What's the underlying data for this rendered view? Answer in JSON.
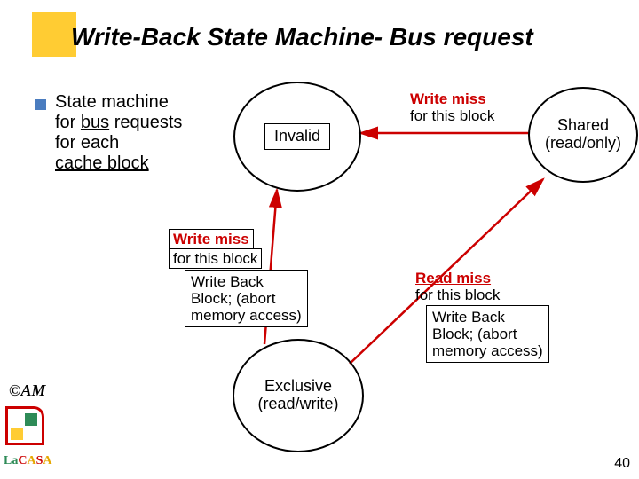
{
  "title": "Write-Back State Machine- Bus request",
  "bullet": {
    "l1": "State machine",
    "l2a": "for ",
    "l2b": "bus",
    "l2c": " requests",
    "l3": " for each",
    "l4": "cache block"
  },
  "states": {
    "invalid": "Invalid",
    "shared_l1": "Shared",
    "shared_l2": "(read/only)",
    "excl_l1": "Exclusive",
    "excl_l2": "(read/write)"
  },
  "edge_top": {
    "hdr": "Write miss",
    "sub": "for this block"
  },
  "edge_left": {
    "hdr": "Write miss",
    "sub": "for this block",
    "act1": "Write Back",
    "act2": "Block; (abort",
    "act3": "memory access)"
  },
  "edge_right": {
    "hdr": "Read miss",
    "sub": "for this block",
    "act1": "Write Back",
    "act2": "Block; (abort",
    "act3": "memory access)"
  },
  "footer": {
    "am": "©AM",
    "la": "La",
    "c": "C",
    "a": "A",
    "s": "S",
    "a2": "A",
    "page": "40"
  }
}
